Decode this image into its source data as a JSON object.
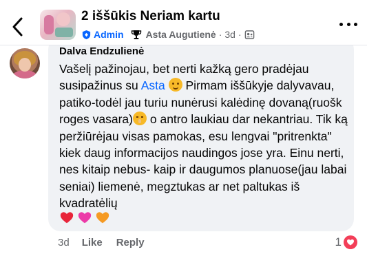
{
  "header": {
    "group_title": "2 iššūkis Neriam kartu",
    "admin_label": "Admin",
    "author": "Asta Augutienė",
    "separator": "·",
    "time": "3d",
    "separator2": "·"
  },
  "comment": {
    "commenter_name": "Dalva Endzulienė",
    "text_parts": {
      "p1": "Vašelį pažinojau, bet nerti kažką gero pradėjau susipažinus su ",
      "mention": "Asta",
      "p2": " Pirmam iššūkyje dalyvavau, patiko-todėl jau turiu nunėrusi kalėdinę dovaną(ruošk roges vasara)",
      "p3": " o antro laukiau dar nekantriau. Tik ką peržiūrėjau visas pamokas, esu lengvai \"pritrenkta\" kiek daug informacijos naudingos jose yra. Einu nerti, nes kitaip nebus- kaip ir daugumos planuose(jau labai seniai) liemenė, megztukas ar net paltukas iš kvadratėlių"
    },
    "hearts": [
      "red-heart",
      "pink-heart",
      "orange-heart"
    ]
  },
  "footer": {
    "time": "3d",
    "like_label": "Like",
    "reply_label": "Reply",
    "reaction_count": "1"
  },
  "colors": {
    "accent": "#0866ff",
    "bubble": "#f0f2f5",
    "love": "#f33e58",
    "heart_red": "#e8253a",
    "heart_pink": "#ec3aa8",
    "heart_orange": "#f59a23"
  }
}
